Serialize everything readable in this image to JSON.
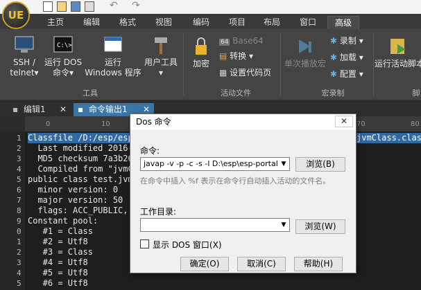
{
  "app": {
    "logo_text": "UE"
  },
  "ribbon_tabs": [
    "主页",
    "编辑",
    "格式",
    "视图",
    "编码",
    "项目",
    "布局",
    "窗口",
    "高级"
  ],
  "ribbon": {
    "ssh": [
      "SSH /",
      "telnet▾"
    ],
    "run_dos": [
      "运行 DOS",
      "命令▾"
    ],
    "run_windows": [
      "运行",
      "Windows 程序"
    ],
    "user_tools": [
      "用户工具",
      "▾"
    ],
    "tools_group": "工具",
    "encrypt": "加密",
    "base64": "Base64",
    "convert": "转换",
    "set_codepage": "设置代码页",
    "active_file_group": "活动文件",
    "single_step": "单次播放宏",
    "record": "录制",
    "load": "加载",
    "config": "配置",
    "macro_group": "宏录制",
    "run_active_script": "运行活动脚本",
    "script_group": "脚"
  },
  "doc_tabs": [
    {
      "label": "编辑1",
      "close": "✕"
    },
    {
      "label": "命令输出1",
      "close": "✕"
    }
  ],
  "ruler": {
    "marks": [
      "0",
      "10",
      "70",
      "80"
    ]
  },
  "editor": {
    "lines": [
      {
        "n": "1",
        "text": "Classfile /D:/esp/esp",
        "tail": "jvmClass.class"
      },
      {
        "n": "",
        "text": "  Last modified 2016-"
      },
      {
        "n": "",
        "text": "  MD5 checksum 7a3b26"
      },
      {
        "n": "",
        "text": "  Compiled from \"jvmC"
      },
      {
        "n": "",
        "text": "public class test.jvm"
      },
      {
        "n": "",
        "text": "  minor version: 0"
      },
      {
        "n": "",
        "text": "  major version: 50"
      },
      {
        "n": "",
        "text": "  flags: ACC_PUBLIC, "
      },
      {
        "n": "",
        "text": "Constant pool:"
      },
      {
        "n": "",
        "text": "   #1 = Class"
      },
      {
        "n": "",
        "text": "   #2 = Utf8"
      },
      {
        "n": "",
        "text": "   #3 = Class"
      },
      {
        "n": "",
        "text": "   #4 = Utf8"
      },
      {
        "n": "",
        "text": "   #5 = Utf8"
      },
      {
        "n": "",
        "text": "   #6 = Utf8"
      }
    ],
    "gutter_nums": [
      "1",
      "2",
      "3",
      "4",
      "5",
      "6",
      "7",
      "8",
      "9",
      "0",
      "1",
      "2",
      "3",
      "4",
      "5"
    ]
  },
  "dialog": {
    "title": "Dos 命令",
    "close": "✕",
    "cmd_label": "命令:",
    "cmd_value": "javap -v -p -c -s -l D:\\esp\\esp-portal\\esp",
    "browse1": "浏览(B)",
    "hint": "在命令中插入 %f 表示在命令行自动插入活动的文件名。",
    "workdir_label": "工作目录:",
    "workdir_value": "",
    "browse2": "浏览(W)",
    "show_dos": "显示 DOS 窗口(X)",
    "ok": "确定(O)",
    "cancel": "取消(C)",
    "help": "帮助(H)"
  }
}
